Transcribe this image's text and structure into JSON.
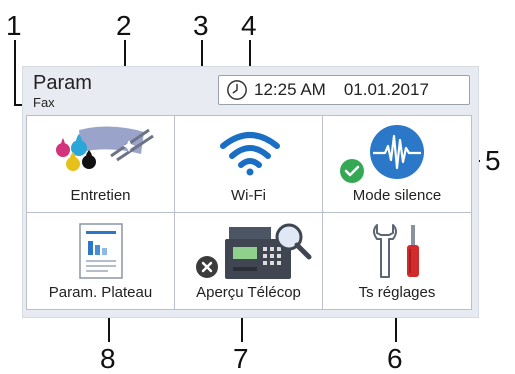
{
  "callouts": [
    "1",
    "2",
    "3",
    "4",
    "5",
    "6",
    "7",
    "8"
  ],
  "header": {
    "title": "Param",
    "subtitle": "Fax",
    "time": "12:25 AM",
    "date": "01.01.2017"
  },
  "tiles": [
    {
      "label": "Entretien",
      "icon": "ink-cartridges-icon"
    },
    {
      "label": "Wi-Fi",
      "icon": "wifi-icon"
    },
    {
      "label": "Mode silence",
      "icon": "silent-mode-icon",
      "badge": "check-badge-icon"
    },
    {
      "label": "Param. Plateau",
      "icon": "tray-document-icon"
    },
    {
      "label": "Aperçu Télécop",
      "icon": "fax-preview-icon",
      "badge": "error-badge-icon"
    },
    {
      "label": "Ts réglages",
      "icon": "tools-icon"
    }
  ],
  "colors": {
    "wifi": "#1a6fc4",
    "silent": "#2b78c8",
    "check": "#34a853",
    "error": "#3b3b3b",
    "screwdriver": "#d22b2b"
  }
}
